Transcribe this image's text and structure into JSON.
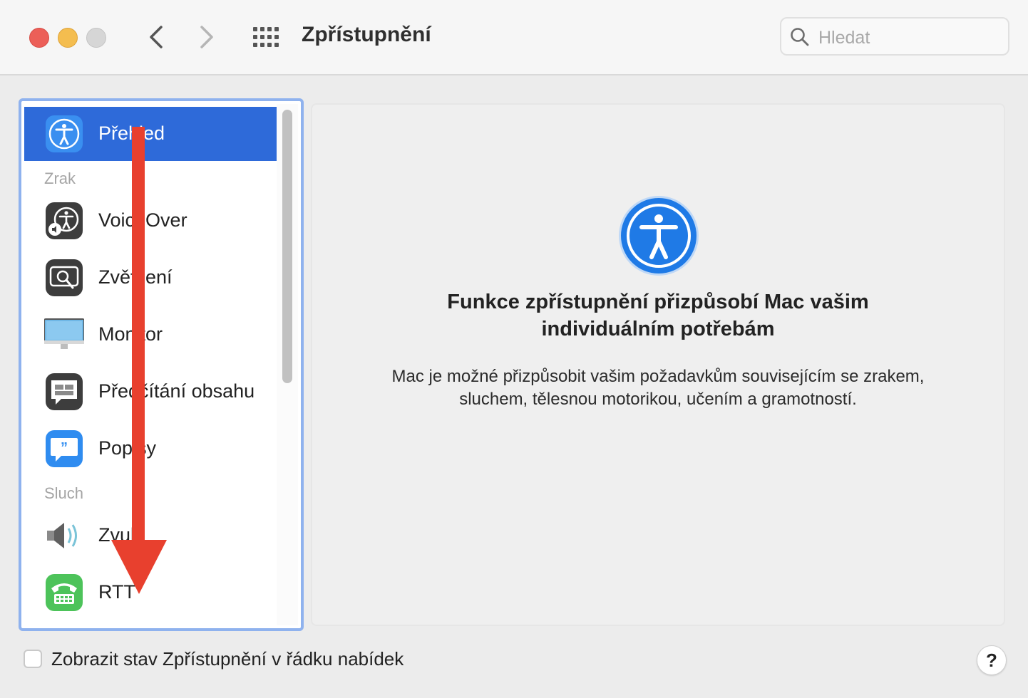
{
  "window": {
    "title": "Zpřístupnění",
    "search_placeholder": "Hledat"
  },
  "sidebar": {
    "items": [
      {
        "label": "Přehled",
        "icon": "accessibility-icon",
        "selected": true
      },
      {
        "label": "VoiceOver",
        "icon": "voiceover-icon"
      },
      {
        "label": "Zvětšení",
        "icon": "zoom-icon"
      },
      {
        "label": "Monitor",
        "icon": "monitor-icon"
      },
      {
        "label": "Předčítání obsahu",
        "icon": "spoken-content-icon"
      },
      {
        "label": "Popisy",
        "icon": "descriptions-icon"
      },
      {
        "label": "Zvuk",
        "icon": "speaker-icon"
      },
      {
        "label": "RTT",
        "icon": "rtt-phone-icon"
      }
    ],
    "sections": [
      "Zrak",
      "Sluch"
    ]
  },
  "detail": {
    "icon": "accessibility-icon",
    "heading_line1": "Funkce zpřístupnění přizpůsobí Mac vašim",
    "heading_line2": "individuálním potřebám",
    "desc_line1": "Mac je možné přizpůsobit vašim požadavkům souvisejícím se zrakem,",
    "desc_line2": "sluchem, tělesnou motorikou, učením a gramotností."
  },
  "footer": {
    "checkbox_label": "Zobrazit stav Zpřístupnění v řádku nabídek",
    "checked": false,
    "help_label": "?"
  },
  "colors": {
    "selection": "#2e6ad9",
    "focus_ring": "#8fb2ee",
    "annotation_arrow": "#e8402e"
  }
}
